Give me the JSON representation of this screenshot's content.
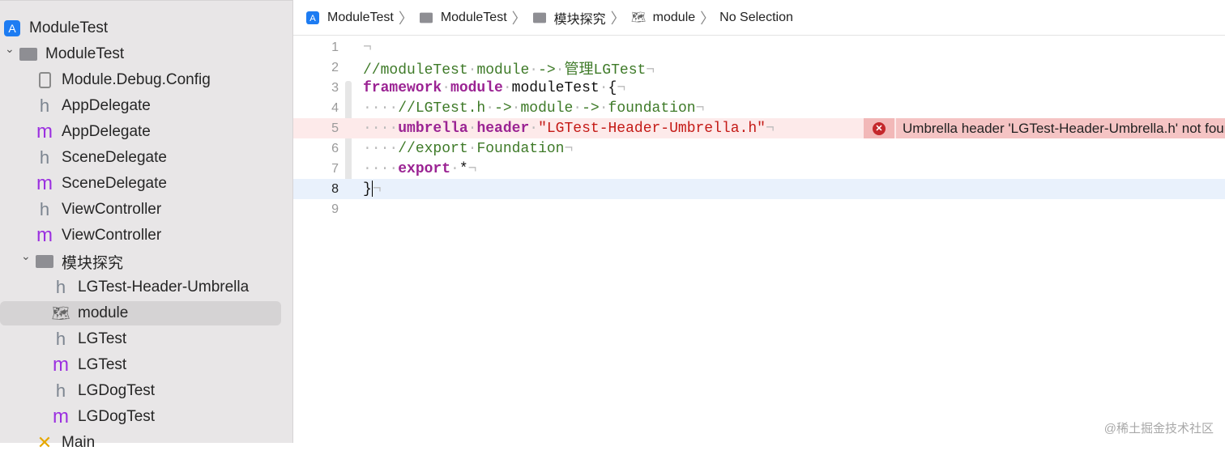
{
  "sidebar": {
    "items": [
      {
        "label": "ModuleTest",
        "icon": "app-icon",
        "indent": 0
      },
      {
        "label": "ModuleTest",
        "icon": "folder-icon",
        "indent": 1,
        "expanded": true
      },
      {
        "label": "Module.Debug.Config",
        "icon": "config-file-icon",
        "indent": 2
      },
      {
        "label": "AppDelegate",
        "icon": "header-file-icon",
        "indent": 2
      },
      {
        "label": "AppDelegate",
        "icon": "objc-file-icon",
        "indent": 2
      },
      {
        "label": "SceneDelegate",
        "icon": "header-file-icon",
        "indent": 2
      },
      {
        "label": "SceneDelegate",
        "icon": "objc-file-icon",
        "indent": 2
      },
      {
        "label": "ViewController",
        "icon": "header-file-icon",
        "indent": 2
      },
      {
        "label": "ViewController",
        "icon": "objc-file-icon",
        "indent": 2
      },
      {
        "label": "模块探究",
        "icon": "folder-icon",
        "indent": 2,
        "expanded": true
      },
      {
        "label": "LGTest-Header-Umbrella",
        "icon": "header-file-icon",
        "indent": 3
      },
      {
        "label": "module",
        "icon": "modulemap-icon",
        "indent": 3,
        "selected": true
      },
      {
        "label": "LGTest",
        "icon": "header-file-icon",
        "indent": 3
      },
      {
        "label": "LGTest",
        "icon": "objc-file-icon",
        "indent": 3
      },
      {
        "label": "LGDogTest",
        "icon": "header-file-icon",
        "indent": 3
      },
      {
        "label": "LGDogTest",
        "icon": "objc-file-icon",
        "indent": 3
      },
      {
        "label": "Main",
        "icon": "storyboard-icon",
        "indent": 2
      }
    ]
  },
  "breadcrumb": [
    {
      "label": "ModuleTest",
      "icon": "app-icon"
    },
    {
      "label": "ModuleTest",
      "icon": "folder-icon"
    },
    {
      "label": "模块探究",
      "icon": "folder-icon"
    },
    {
      "label": "module",
      "icon": "modulemap-icon"
    },
    {
      "label": "No Selection",
      "icon": ""
    }
  ],
  "editor": {
    "lines": [
      {
        "n": "1",
        "tokens": [
          [
            "ws",
            "¬"
          ]
        ]
      },
      {
        "n": "2",
        "tokens": [
          [
            "cm",
            "//moduleTest"
          ],
          [
            "ws",
            "·"
          ],
          [
            "cm",
            "module"
          ],
          [
            "ws",
            "·"
          ],
          [
            "cm",
            "->"
          ],
          [
            "ws",
            "·"
          ],
          [
            "cm",
            "管理LGTest"
          ],
          [
            "ws",
            "¬"
          ]
        ]
      },
      {
        "n": "3",
        "tokens": [
          [
            "kw",
            "framework"
          ],
          [
            "ws",
            "·"
          ],
          [
            "kw",
            "module"
          ],
          [
            "ws",
            "·"
          ],
          [
            "pl",
            "moduleTest"
          ],
          [
            "ws",
            "·"
          ],
          [
            "pl",
            "{"
          ],
          [
            "ws",
            "¬"
          ]
        ]
      },
      {
        "n": "4",
        "tokens": [
          [
            "ws",
            "····"
          ],
          [
            "cm",
            "//LGTest.h"
          ],
          [
            "ws",
            "·"
          ],
          [
            "cm",
            "->"
          ],
          [
            "ws",
            "·"
          ],
          [
            "cm",
            "module"
          ],
          [
            "ws",
            "·"
          ],
          [
            "cm",
            "->"
          ],
          [
            "ws",
            "·"
          ],
          [
            "cm",
            "foundation"
          ],
          [
            "ws",
            "¬"
          ]
        ]
      },
      {
        "n": "5",
        "error": true,
        "tokens": [
          [
            "ws",
            "····"
          ],
          [
            "kw",
            "umbrella"
          ],
          [
            "ws",
            "·"
          ],
          [
            "kw",
            "header"
          ],
          [
            "ws",
            "·"
          ],
          [
            "st",
            "\"LGTest-Header-Umbrella.h\""
          ],
          [
            "ws",
            "¬"
          ]
        ]
      },
      {
        "n": "6",
        "tokens": [
          [
            "ws",
            "····"
          ],
          [
            "cm",
            "//export"
          ],
          [
            "ws",
            "·"
          ],
          [
            "cm",
            "Foundation"
          ],
          [
            "ws",
            "¬"
          ]
        ]
      },
      {
        "n": "7",
        "tokens": [
          [
            "ws",
            "····"
          ],
          [
            "kw",
            "export"
          ],
          [
            "ws",
            "·"
          ],
          [
            "pl",
            "*"
          ],
          [
            "ws",
            "¬"
          ]
        ]
      },
      {
        "n": "8",
        "current": true,
        "tokens": [
          [
            "pl",
            "}"
          ],
          [
            "ws",
            "¬"
          ]
        ]
      },
      {
        "n": "9",
        "tokens": []
      }
    ],
    "error_message": "Umbrella header 'LGTest-Header-Umbrella.h' not found"
  },
  "watermark": "@稀土掘金技术社区",
  "colors": {
    "keyword": "#9b2393",
    "comment": "#3e7a28",
    "string": "#c41a16",
    "error_bg": "#fdeaea",
    "current_line": "#e9f1fc"
  }
}
